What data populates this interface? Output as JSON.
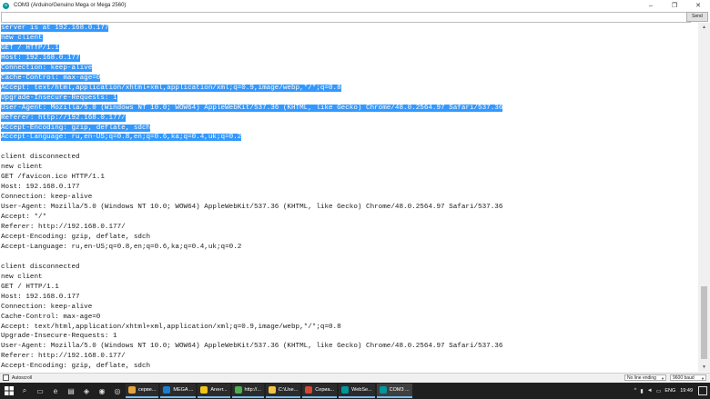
{
  "window": {
    "title": "COM3 (Arduino/Genuino Mega or Mega 2560)",
    "buttons": [
      "–",
      "❐",
      "✕"
    ]
  },
  "send_bar": {
    "input_value": "",
    "send_label": "Send"
  },
  "serial_output": {
    "lines": [
      {
        "text": "server is at 192.168.0.177",
        "selected": true
      },
      {
        "text": "new client",
        "selected": true
      },
      {
        "text": "GET / HTTP/1.1",
        "selected": true
      },
      {
        "text": "Host: 192.168.0.177",
        "selected": true
      },
      {
        "text": "Connection: keep-alive",
        "selected": true
      },
      {
        "text": "Cache-Control: max-age=0",
        "selected": true
      },
      {
        "text": "Accept: text/html,application/xhtml+xml,application/xml;q=0.9,image/webp,*/*;q=0.8",
        "selected": true
      },
      {
        "text": "Upgrade-Insecure-Requests: 1",
        "selected": true
      },
      {
        "text": "User-Agent: Mozilla/5.0 (Windows NT 10.0; WOW64) AppleWebKit/537.36 (KHTML, like Gecko) Chrome/48.0.2564.97 Safari/537.36",
        "selected": true
      },
      {
        "text": "Referer: http://192.168.0.177/",
        "selected": true
      },
      {
        "text": "Accept-Encoding: gzip, deflate, sdch",
        "selected": true
      },
      {
        "text": "Accept-Language: ru,en-US;q=0.8,en;q=0.6,ka;q=0.4,uk;q=0.2",
        "selected": true
      },
      {
        "text": "",
        "selected": false
      },
      {
        "text": "client disconnected",
        "selected": false
      },
      {
        "text": "new client",
        "selected": false
      },
      {
        "text": "GET /favicon.ico HTTP/1.1",
        "selected": false
      },
      {
        "text": "Host: 192.168.0.177",
        "selected": false
      },
      {
        "text": "Connection: keep-alive",
        "selected": false
      },
      {
        "text": "User-Agent: Mozilla/5.0 (Windows NT 10.0; WOW64) AppleWebKit/537.36 (KHTML, like Gecko) Chrome/48.0.2564.97 Safari/537.36",
        "selected": false
      },
      {
        "text": "Accept: */*",
        "selected": false
      },
      {
        "text": "Referer: http://192.168.0.177/",
        "selected": false
      },
      {
        "text": "Accept-Encoding: gzip, deflate, sdch",
        "selected": false
      },
      {
        "text": "Accept-Language: ru,en-US;q=0.8,en;q=0.6,ka;q=0.4,uk;q=0.2",
        "selected": false
      },
      {
        "text": "",
        "selected": false
      },
      {
        "text": "client disconnected",
        "selected": false
      },
      {
        "text": "new client",
        "selected": false
      },
      {
        "text": "GET / HTTP/1.1",
        "selected": false
      },
      {
        "text": "Host: 192.168.0.177",
        "selected": false
      },
      {
        "text": "Connection: keep-alive",
        "selected": false
      },
      {
        "text": "Cache-Control: max-age=0",
        "selected": false
      },
      {
        "text": "Accept: text/html,application/xhtml+xml,application/xml;q=0.9,image/webp,*/*;q=0.8",
        "selected": false
      },
      {
        "text": "Upgrade-Insecure-Requests: 1",
        "selected": false
      },
      {
        "text": "User-Agent: Mozilla/5.0 (Windows NT 10.0; WOW64) AppleWebKit/537.36 (KHTML, like Gecko) Chrome/48.0.2564.97 Safari/537.36",
        "selected": false
      },
      {
        "text": "Referer: http://192.168.0.177/",
        "selected": false
      },
      {
        "text": "Accept-Encoding: gzip, deflate, sdch",
        "selected": false
      }
    ]
  },
  "bottom_bar": {
    "autoscroll_label": "Autoscroll",
    "autoscroll_checked": false,
    "line_ending": "No line ending",
    "baud_rate": "9600 baud"
  },
  "taskbar": {
    "apps": [
      {
        "label": "серве...",
        "color": "#e8a33c",
        "active": false
      },
      {
        "label": "MEGA ...",
        "color": "#1a7fd1",
        "active": false
      },
      {
        "label": "Агент...",
        "color": "#f0c419",
        "active": false
      },
      {
        "label": "http://...",
        "color": "#4caf50",
        "active": false
      },
      {
        "label": "C:\\Use...",
        "color": "#f4c542",
        "active": false
      },
      {
        "label": "Сериа...",
        "color": "#d14836",
        "active": false
      },
      {
        "label": "WebSe...",
        "color": "#00979c",
        "active": false
      },
      {
        "label": "COM3 ...",
        "color": "#00979c",
        "active": true
      }
    ],
    "language": "ENG",
    "clock": "19:49"
  },
  "colors": {
    "selection": "#3399ff",
    "arduino_teal": "#00979c",
    "taskbar": "#1f1f1f"
  }
}
